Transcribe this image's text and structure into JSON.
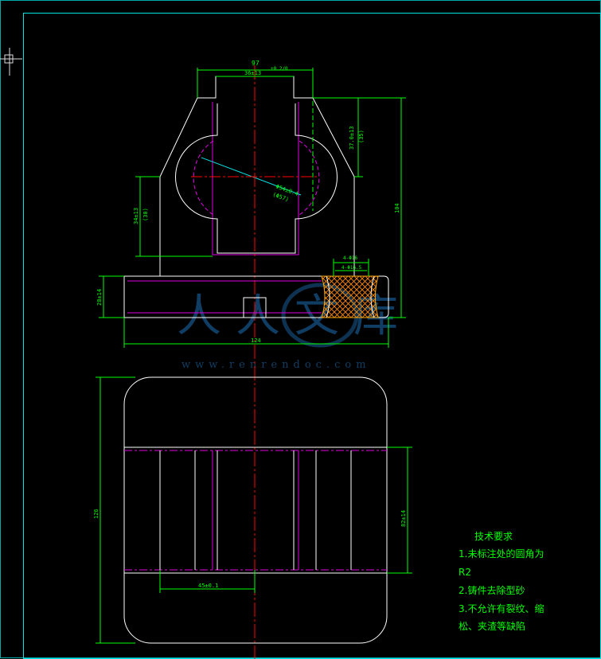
{
  "colors": {
    "background": "#000000",
    "frame": "#00e5e5",
    "outline": "#ffffff",
    "inner": "#e000e0",
    "dimension": "#00ff00",
    "centerline": "#ff0000",
    "hatch": "#ff8a00",
    "watermark": "#1e6fb5"
  },
  "dimensions": {
    "top_width": "97",
    "top_width_tol": "+0.2/0",
    "slot_width": "36±13",
    "right_height": "37.0±13",
    "right_height_paren": "(35)",
    "circle_dia": "Φ54±0.4",
    "circle_dia_paren": "(Φ57)",
    "left_height": "34±13",
    "left_height_paren": "(30)",
    "total_height": "104",
    "base_height": "28±14",
    "hole_top": "4-Φ16",
    "hole_bottom": "4-Φ16.5",
    "base_width": "124",
    "plan_height": "126",
    "plan_inner_height": "82±14",
    "plan_slot": "45±0.1"
  },
  "notes": {
    "title": "技术要求",
    "line1": "1.未标注处的圆角为",
    "line2": "R2",
    "line3": "2.铸件去除型砂",
    "line4": "3.不允许有裂纹、缩",
    "line5": "松、夹渣等缺陷"
  },
  "watermark": {
    "brand": "人人文库",
    "url": "www.renrendoc.com"
  }
}
